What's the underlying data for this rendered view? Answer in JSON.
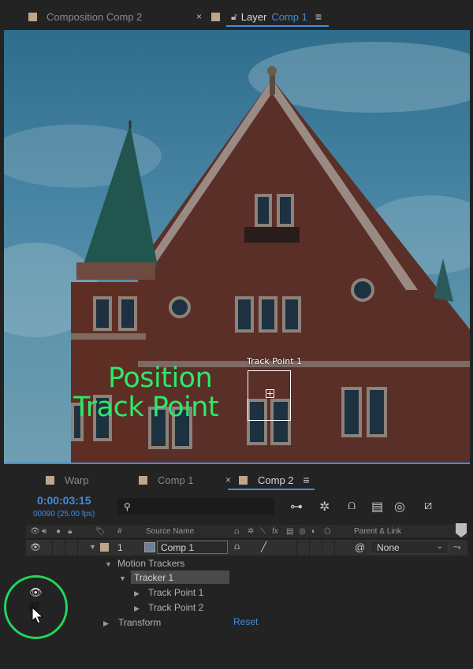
{
  "top_tabs": {
    "composition_tab": "Composition Comp 2",
    "layer_prefix": "Layer",
    "layer_name": "Comp 1"
  },
  "viewer": {
    "overlay_line1": "Position",
    "overlay_line2": "Track Point",
    "track_point_label": "Track Point 1"
  },
  "timeline": {
    "tabs": [
      "Warp",
      "Comp 1",
      "Comp 2"
    ],
    "timecode": "0:00:03:15",
    "frame_info": "00090 (25.00 fps)",
    "search_placeholder": "",
    "columns": {
      "number": "#",
      "source_name": "Source Name",
      "fx": "fx",
      "parent_link": "Parent & Link"
    },
    "layer": {
      "number": "1",
      "name": "Comp 1",
      "parent": "None"
    },
    "properties": {
      "motion_trackers": "Motion Trackers",
      "tracker": "Tracker 1",
      "track_point_1": "Track Point 1",
      "track_point_2": "Track Point 2",
      "transform": "Transform",
      "reset": "Reset"
    }
  },
  "colors": {
    "accent_blue": "#3e8de0",
    "overlay_green": "#2ee86a",
    "highlight_circle": "#23d65c",
    "label_swatch": "#bfa58a"
  }
}
